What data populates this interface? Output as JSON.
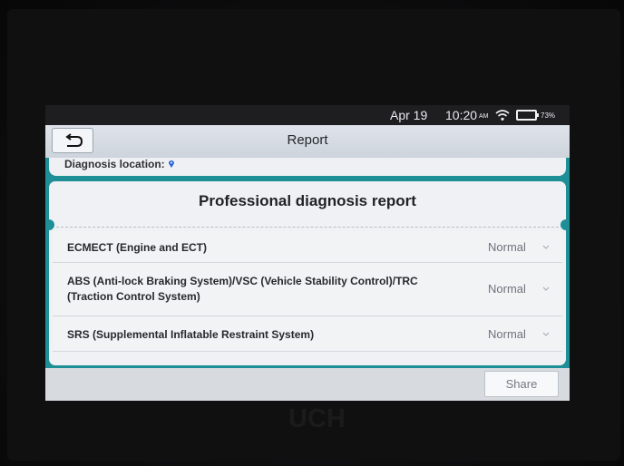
{
  "status_bar": {
    "date": "Apr 19",
    "time": "10:20",
    "am_pm": "AM",
    "battery": "73%",
    "wifi_icon": "wifi-icon",
    "battery_icon": "battery-icon"
  },
  "header": {
    "title": "Report",
    "back_icon": "return-arrow-icon"
  },
  "diagnosis": {
    "location_label": "Diagnosis location:",
    "pin_icon": "location-pin-icon"
  },
  "report": {
    "title": "Professional diagnosis report",
    "systems": [
      {
        "name": "ECMECT (Engine and ECT)",
        "status": "Normal"
      },
      {
        "name": "ABS (Anti-lock Braking System)/VSC (Vehicle Stability Control)/TRC (Traction Control System)",
        "status": "Normal"
      },
      {
        "name": "SRS (Supplemental Inflatable Restraint System)",
        "status": "Normal"
      }
    ]
  },
  "footer": {
    "share_label": "Share"
  },
  "device": {
    "brand_partial": "UCH"
  },
  "colors": {
    "accent": "#1e8f96",
    "header": "#d8dde4",
    "card": "#eff1f4"
  }
}
